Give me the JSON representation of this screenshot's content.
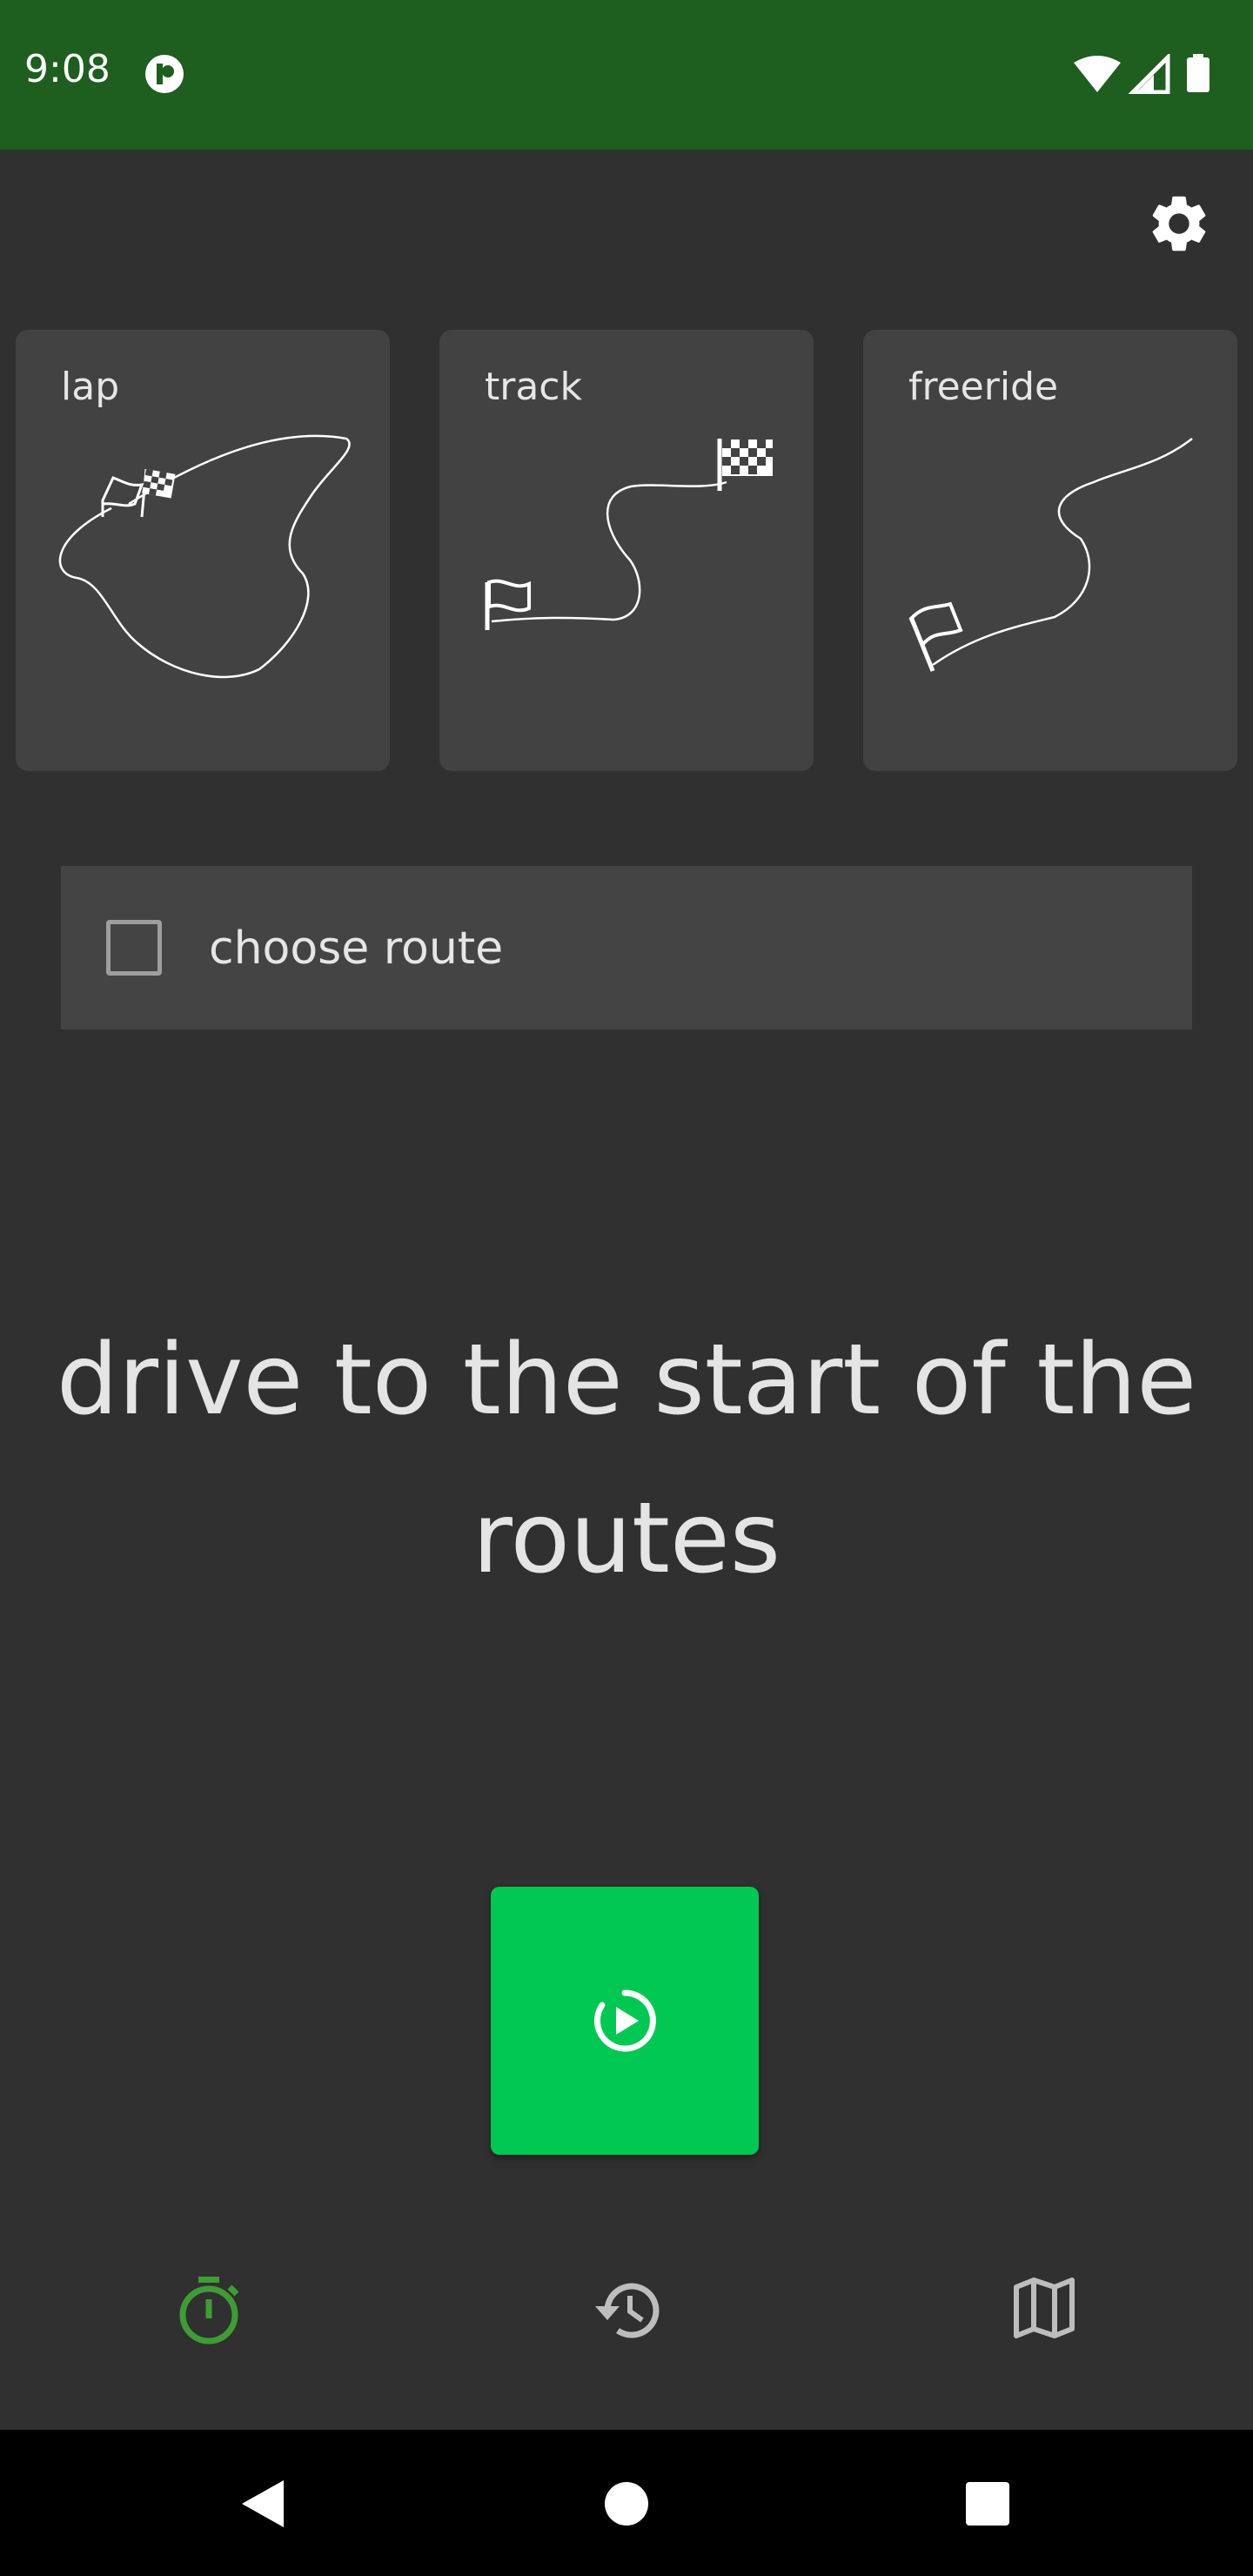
{
  "status_bar": {
    "time": "9:08",
    "app_icon": "app-notification-icon",
    "right_icons": [
      "wifi-icon",
      "signal-icon",
      "battery-icon"
    ]
  },
  "header": {
    "settings_icon": "gear-icon"
  },
  "modes": [
    {
      "label": "lap",
      "icon": "lap-route-illustration"
    },
    {
      "label": "track",
      "icon": "track-route-illustration"
    },
    {
      "label": "freeride",
      "icon": "freeride-route-illustration"
    }
  ],
  "route_option": {
    "label": "choose route",
    "checked": false
  },
  "message": "drive to the start of the routes",
  "start_button": {
    "icon": "timer-play-icon",
    "color": "#00c853"
  },
  "bottom_nav": {
    "items": [
      {
        "icon": "stopwatch-icon",
        "active": true
      },
      {
        "icon": "history-icon",
        "active": false
      },
      {
        "icon": "map-icon",
        "active": false
      }
    ],
    "active_color": "#3f9c35",
    "inactive_color": "#bdbdbd"
  },
  "system_nav": [
    "back-icon",
    "home-icon",
    "recents-icon"
  ],
  "colors": {
    "status_bar": "#1e5e1f",
    "background": "#303030",
    "card": "#424242"
  }
}
